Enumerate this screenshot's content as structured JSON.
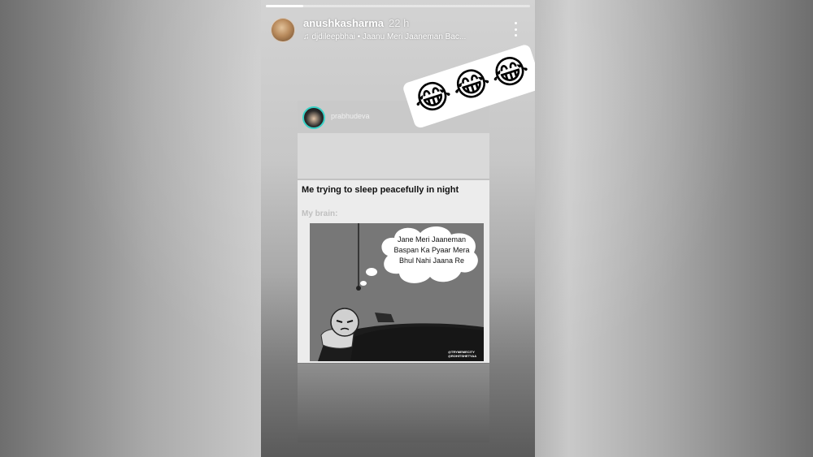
{
  "story": {
    "username": "anushkasharma",
    "time": "22 h",
    "music_icon": "music-note-icon",
    "music_text": "djdileepbhai • Jaanu Meri Jaaneman Bac...",
    "more_icon": "more-vertical-icon",
    "progress_fraction": 0.14
  },
  "shared_post": {
    "username": "prabhudeva"
  },
  "sticker": {
    "emojis": [
      "😂",
      "😂",
      "😂"
    ]
  },
  "meme": {
    "title": "Me trying to sleep peacefully in night",
    "subtitle": "My brain:",
    "thought_bubble": [
      "Jane Meri Jaaneman",
      "Baspan Ka Pyaar Mera",
      "Bhul Nahi Jaana Re"
    ],
    "watermark": "@TRYMEMECITY @ROHITSHETYAA"
  }
}
